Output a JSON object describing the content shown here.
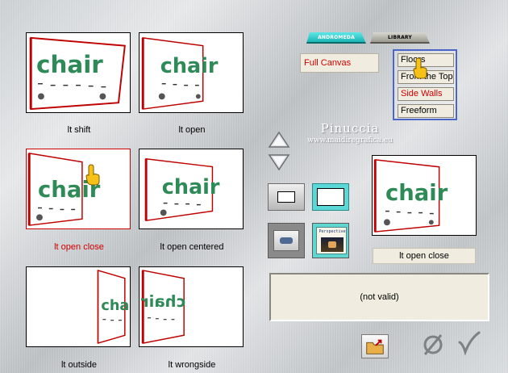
{
  "tabs": [
    {
      "label": "ANDROMEDA",
      "active": true
    },
    {
      "label": "LIBRARY",
      "active": false
    }
  ],
  "modes": {
    "selected": "Full Canvas",
    "items": [
      {
        "label": "Floors",
        "active": false
      },
      {
        "label": "From the Top",
        "active": false
      },
      {
        "label": "Side Walls",
        "active": true
      },
      {
        "label": "Freeform",
        "active": false
      }
    ]
  },
  "watermark": {
    "name": "Pinuccia",
    "site": "www.maidiregrafica.eu"
  },
  "thumbnails": [
    {
      "label": "lt shift",
      "selected": false
    },
    {
      "label": "lt open",
      "selected": false
    },
    {
      "label": "lt open close",
      "selected": true
    },
    {
      "label": "lt open centered",
      "selected": false
    },
    {
      "label": "lt outside",
      "selected": false
    },
    {
      "label": "lt wrongside",
      "selected": false
    }
  ],
  "thumbnail_word": "chair",
  "button_images": {
    "perspective_caption": "Perspective"
  },
  "preview": {
    "label": "lt open close"
  },
  "status": {
    "text": "(not valid)"
  },
  "colors": {
    "selected_text": "#d00000",
    "chair_green": "#2e8b57",
    "frame_red": "#c00000",
    "menu_border": "#4a64c8"
  }
}
